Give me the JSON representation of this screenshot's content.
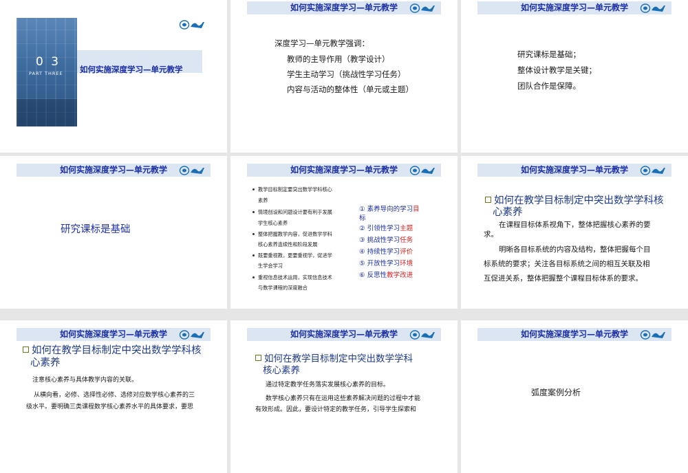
{
  "slides": [
    {
      "number_text": "0 3",
      "part_label": "PART THREE",
      "title": "如何实施深度学习—单元教学"
    },
    {
      "header": "如何实施深度学习—单元教学",
      "lead": "深度学习—单元教学强调：",
      "items": [
        "教师的主导作用（教学设计）",
        "学生主动学习（挑战性学习任务）",
        "内容与活动的整体性（单元或主题）"
      ]
    },
    {
      "header": "如何实施深度学习—单元教学",
      "lines": [
        "研究课标是基础；",
        "整体设计教学是关键；",
        "团队合作是保障。"
      ]
    },
    {
      "header": "如何实施深度学习—单元教学",
      "big_text": "研究课标是基础"
    },
    {
      "header": "如何实施深度学习—单元教学",
      "bullets": [
        [
          "教学目标制定要突出数学学科核心",
          "素养"
        ],
        [
          "情境创设和问题设计要有利于发展",
          "学生核心素养"
        ],
        [
          "整体把握教学内容，促进数学学科",
          "核心素养连续性和阶段发展"
        ],
        [
          "既要重视教，更要重视学，促进学",
          "生学会学习"
        ],
        [
          "重视信息技术运用，实现信息技术",
          "与数学课程的深度融合"
        ]
      ],
      "numbered": [
        {
          "num": "①",
          "a": "素养导向的学习",
          "b": "目",
          "c": "标"
        },
        {
          "num": "②",
          "a": "引领性学习",
          "b": "主题"
        },
        {
          "num": "③",
          "a": "挑战性学习",
          "b": "任务"
        },
        {
          "num": "④",
          "a": "持续性学习",
          "b": "评价"
        },
        {
          "num": "⑤",
          "a": "开放性学习",
          "b": "环境"
        },
        {
          "num": "⑥",
          "a": "反思性",
          "b": "教学改进"
        }
      ]
    },
    {
      "header": "如何实施深度学习—单元教学",
      "heading_l1": "如何在教学目标制定中突出数学学科核",
      "heading_l2": "心素养",
      "p1_l1": "在课程目标体系视角下，整体把握核心素养的要",
      "p1_l2": "求。",
      "p2_l1": "明晰各目标系统的内容及结构，整体把握每个目",
      "p2_l2": "标系统的要求；关注各目标系统之间的相互关联及相",
      "p2_l3": "互促进关系，整体把握整个课程目标体系的要求。"
    },
    {
      "header": "如何实施深度学习—单元教学",
      "heading_l1": "如何在教学目标制定中突出数学学科核",
      "heading_l2": "心素养",
      "p1": "注意核心素养与具体教学内容的关联。",
      "p2_l1": "从横向看，必修、选择性必修、选修对应数学核心素养的三",
      "p2_l2": "级水平。要明确三类课程数学核心素养水平的具体要求，要思"
    },
    {
      "header": "如何实施深度学习—单元教学",
      "heading_l1": "如何在教学目标制定中突出数学学科",
      "heading_l2": "核心素养",
      "p1": "通过特定教学任务落实发展核心素养的目标。",
      "p2_l1": "数学核心素养只有在运用这些素养解决问题的过程中才能",
      "p2_l2": "有效形成。因此，要设计特定的教学任务，引导学生探索和"
    },
    {
      "header": "如何实施深度学习—单元教学",
      "center_text": "弧度案例分析"
    }
  ],
  "colors": {
    "band": "#dce6f3",
    "title_blue": "#1a2ea6",
    "accent_red": "#dd2222",
    "cover_blue": "#3d6b9e"
  }
}
